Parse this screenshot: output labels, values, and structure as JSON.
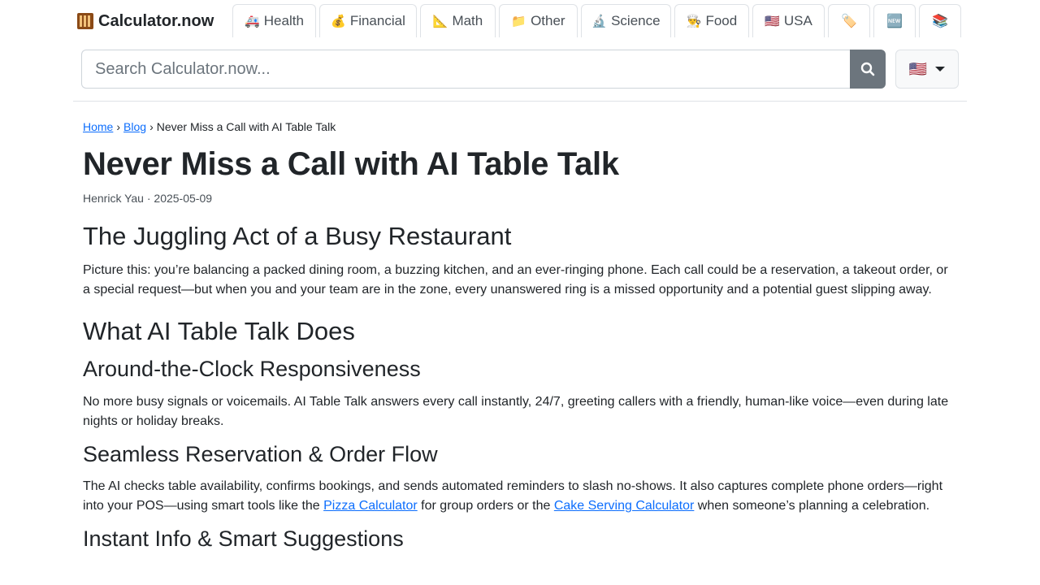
{
  "brand": {
    "name": "Calculator.now",
    "icon": "abacus-icon"
  },
  "tabs": [
    {
      "label": "Health",
      "icon": "🚑",
      "icon_name": "ambulance-icon"
    },
    {
      "label": "Financial",
      "icon": "💰",
      "icon_name": "money-bag-icon"
    },
    {
      "label": "Math",
      "icon": "📐",
      "icon_name": "triangle-ruler-icon"
    },
    {
      "label": "Other",
      "icon": "📁",
      "icon_name": "folder-icon"
    },
    {
      "label": "Science",
      "icon": "🔬",
      "icon_name": "microscope-icon"
    },
    {
      "label": "Food",
      "icon": "👨‍🍳",
      "icon_name": "chef-icon"
    },
    {
      "label": "USA",
      "icon": "🇺🇸",
      "icon_name": "us-flag-icon"
    },
    {
      "label": "",
      "icon": "🏷️",
      "icon_name": "tag-icon"
    },
    {
      "label": "",
      "icon": "🆕",
      "icon_name": "new-badge-icon"
    },
    {
      "label": "",
      "icon": "📚",
      "icon_name": "books-icon"
    }
  ],
  "search": {
    "placeholder": "Search Calculator.now...",
    "button_icon": "search-icon"
  },
  "language": {
    "flag": "🇺🇸",
    "icon": "us-flag-icon"
  },
  "breadcrumb": {
    "home": "Home",
    "blog": "Blog",
    "current": "Never Miss a Call with AI Table Talk",
    "separator": "›"
  },
  "article": {
    "title": "Never Miss a Call with AI Table Talk",
    "meta": "Henrick Yau · 2025-05-09",
    "section1": {
      "heading": "The Juggling Act of a Busy Restaurant",
      "text": "Picture this: you’re balancing a packed dining room, a buzzing kitchen, and an ever-ringing phone. Each call could be a reservation, a takeout order, or a special request—but when you and your team are in the zone, every unanswered ring is a missed opportunity and a potential guest slipping away."
    },
    "section2": {
      "heading": "What AI Table Talk Does"
    },
    "sub1": {
      "heading": "Around-the-Clock Responsiveness",
      "text": "No more busy signals or voicemails. AI Table Talk answers every call instantly, 24/7, greeting callers with a friendly, human-like voice—even during late nights or holiday breaks."
    },
    "sub2": {
      "heading": "Seamless Reservation & Order Flow",
      "text_before": "The AI checks table availability, confirms bookings, and sends automated reminders to slash no-shows. It also captures complete phone orders—right into your POS—using smart tools like the ",
      "link1": "Pizza Calculator",
      "text_middle": " for group orders or the ",
      "link2": "Cake Serving Calculator",
      "text_after": " when someone’s planning a celebration."
    },
    "sub3": {
      "heading": "Instant Info & Smart Suggestions"
    }
  },
  "colors": {
    "link": "#0d6efd",
    "search_button": "#6c757d",
    "border": "#dee2e6",
    "text": "#212529"
  }
}
